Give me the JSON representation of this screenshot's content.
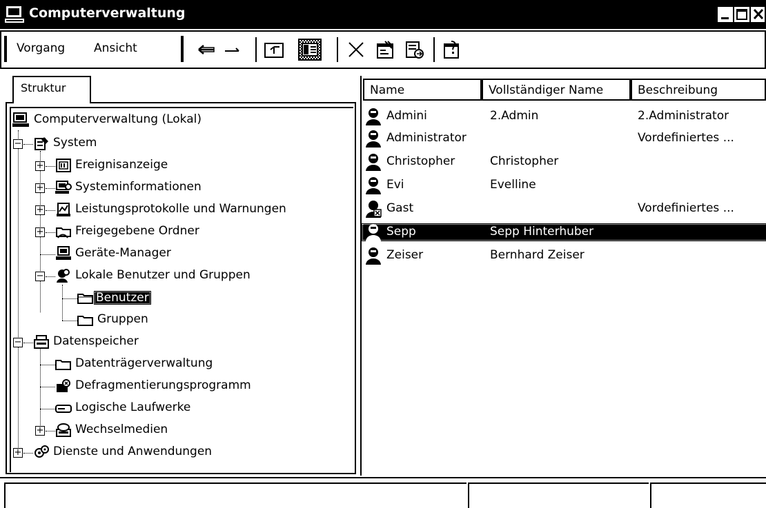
{
  "window": {
    "title": "Computerverwaltung"
  },
  "menu": {
    "vorgang": "Vorgang",
    "ansicht": "Ansicht"
  },
  "toolbar_icons": [
    "back-arrow-icon",
    "forward-arrow-icon",
    "up-folder-icon",
    "show-hide-tree-icon",
    "delete-icon",
    "properties-icon",
    "export-list-icon",
    "help-icon"
  ],
  "left": {
    "tab_label": "Struktur",
    "tree": [
      {
        "label": "Computerverwaltung (Lokal)",
        "icon": "computer-icon"
      },
      {
        "label": "System",
        "icon": "system-tools-icon",
        "expander": "−"
      },
      {
        "label": "Ereignisanzeige",
        "icon": "event-viewer-icon",
        "expander": "+"
      },
      {
        "label": "Systeminformationen",
        "icon": "system-info-icon",
        "expander": "+"
      },
      {
        "label": "Leistungsprotokolle und Warnungen",
        "icon": "performance-logs-icon",
        "expander": "+"
      },
      {
        "label": "Freigegebene Ordner",
        "icon": "shared-folders-icon",
        "expander": "+"
      },
      {
        "label": "Geräte-Manager",
        "icon": "device-manager-icon"
      },
      {
        "label": "Lokale Benutzer und Gruppen",
        "icon": "local-users-groups-icon",
        "expander": "−"
      },
      {
        "label": "Benutzer",
        "icon": "folder-icon",
        "selected": true
      },
      {
        "label": "Gruppen",
        "icon": "folder-icon"
      },
      {
        "label": "Datenspeicher",
        "icon": "storage-icon",
        "expander": "−"
      },
      {
        "label": "Datenträgerverwaltung",
        "icon": "folder-icon"
      },
      {
        "label": "Defragmentierungsprogramm",
        "icon": "defragmenter-icon"
      },
      {
        "label": "Logische Laufwerke",
        "icon": "logical-drive-icon"
      },
      {
        "label": "Wechselmedien",
        "icon": "removable-storage-icon",
        "expander": "+"
      },
      {
        "label": "Dienste und Anwendungen",
        "icon": "services-applications-icon",
        "expander": "+"
      }
    ]
  },
  "right": {
    "columns": [
      "Name",
      "Vollständiger Name",
      "Beschreibung"
    ],
    "rows": [
      {
        "name": "Admini",
        "full_name": "2.Admin",
        "description": "2.Administrator"
      },
      {
        "name": "Administrator",
        "full_name": "",
        "description": "Vordefiniertes ..."
      },
      {
        "name": "Christopher",
        "full_name": "Christopher",
        "description": ""
      },
      {
        "name": "Evi",
        "full_name": "Evelline",
        "description": ""
      },
      {
        "name": "Gast",
        "full_name": "",
        "description": "Vordefiniertes ...",
        "disabled": true
      },
      {
        "name": "Sepp",
        "full_name": "Sepp Hinterhuber",
        "description": "",
        "selected": true
      },
      {
        "name": "Zeiser",
        "full_name": "Bernhard Zeiser",
        "description": ""
      }
    ]
  },
  "colors": {
    "selection_bg": "#000000",
    "selection_fg": "#ffffff",
    "background": "#ffffff"
  }
}
